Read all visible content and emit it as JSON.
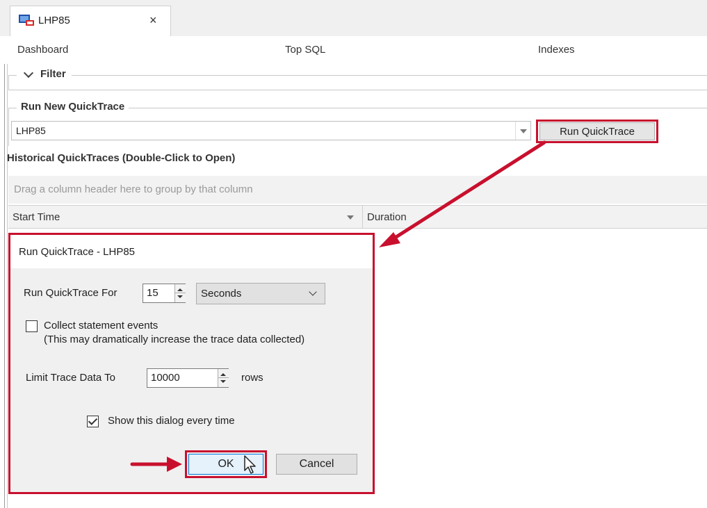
{
  "tab": {
    "title": "LHP85",
    "close_glyph": "×"
  },
  "nav": {
    "items": [
      "Dashboard",
      "Top SQL",
      "Indexes"
    ]
  },
  "filter": {
    "label": "Filter"
  },
  "run_new": {
    "label": "Run New QuickTrace",
    "server": "LHP85",
    "run_button": "Run QuickTrace"
  },
  "historical": {
    "title": "Historical QuickTraces (Double-Click to Open)",
    "group_hint": "Drag a column header here to group by that column",
    "columns": [
      "Start Time",
      "Duration"
    ]
  },
  "dialog": {
    "title": "Run QuickTrace - LHP85",
    "run_for_label": "Run QuickTrace For",
    "run_for_value": "15",
    "unit": "Seconds",
    "collect_label": "Collect statement events",
    "collect_note": "(This may dramatically increase the trace data collected)",
    "collect_checked": false,
    "limit_label": "Limit Trace Data To",
    "limit_value": "10000",
    "limit_unit": "rows",
    "show_label": "Show this dialog every time",
    "show_checked": true,
    "ok": "OK",
    "cancel": "Cancel"
  },
  "colors": {
    "highlight": "#c8102e",
    "ok_border": "#0078d7",
    "ok_fill": "#e5f1fb"
  }
}
